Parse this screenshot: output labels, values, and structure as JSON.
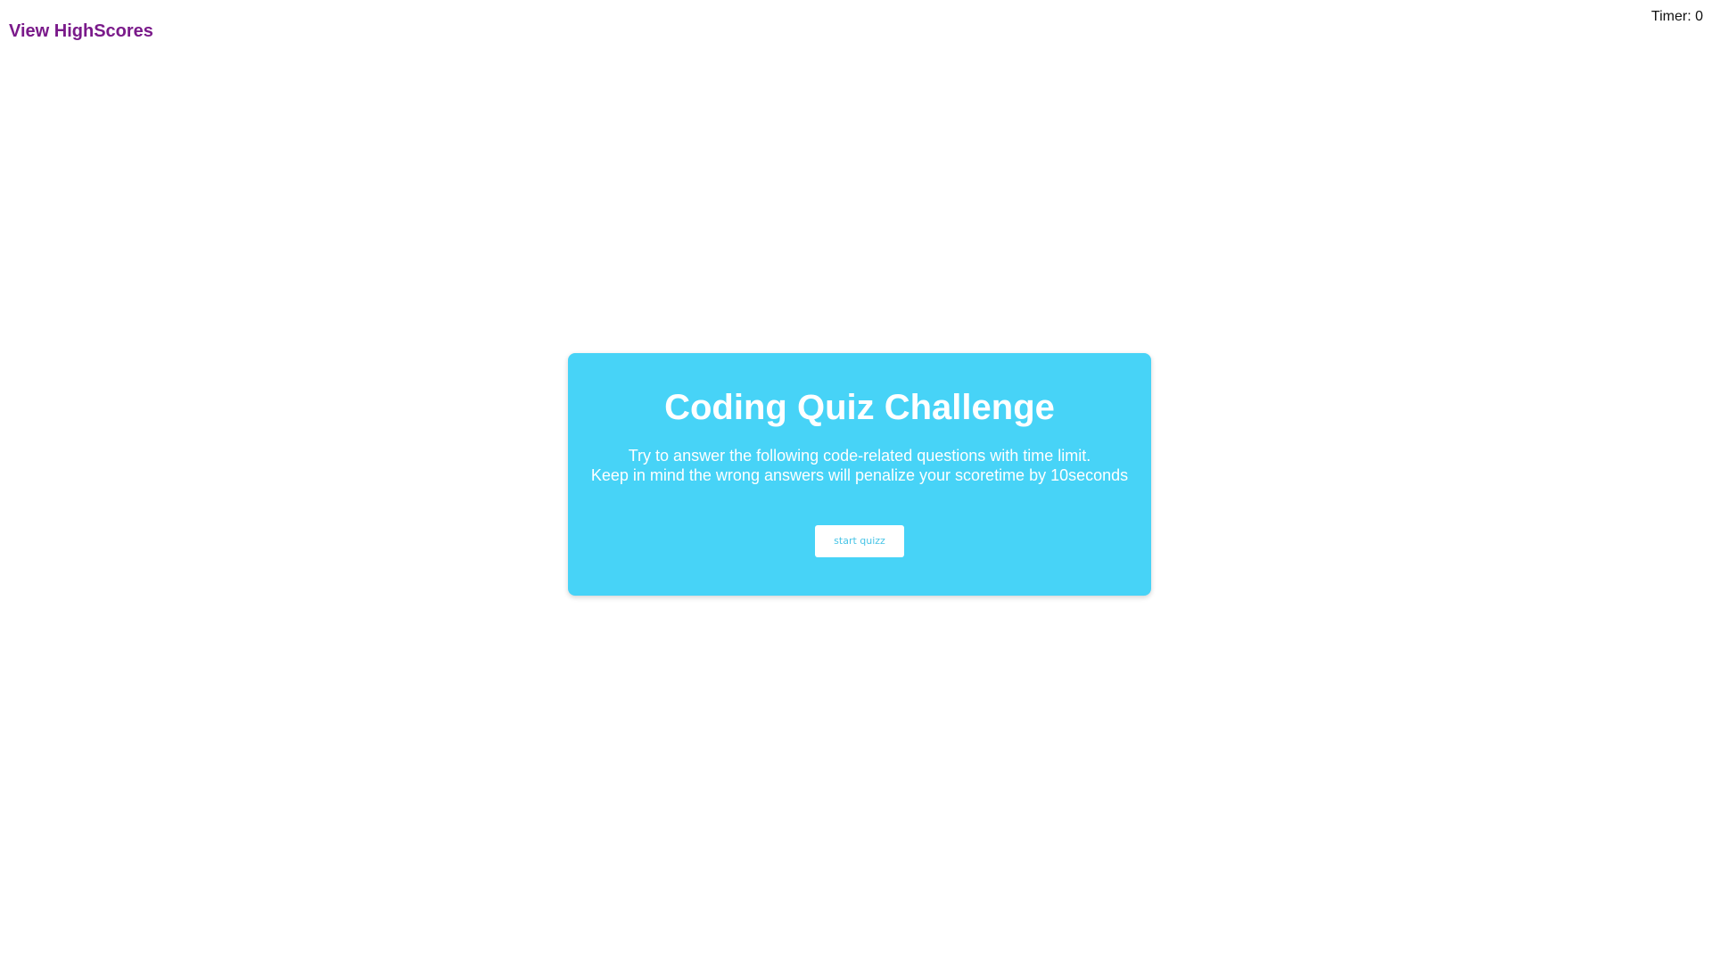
{
  "header": {
    "highscores_link": "View HighScores",
    "timer": "Timer: 0"
  },
  "quiz_card": {
    "title": "Coding Quiz Challenge",
    "description_line1": "Try to answer the following code-related questions with time limit.",
    "description_line2": "Keep in mind the wrong answers will penalize your scoretime by 10seconds",
    "start_button": "start quizz"
  },
  "colors": {
    "card_background": "#47d3f7",
    "link": "#7a1a8a",
    "button_text": "#47c4e6"
  }
}
